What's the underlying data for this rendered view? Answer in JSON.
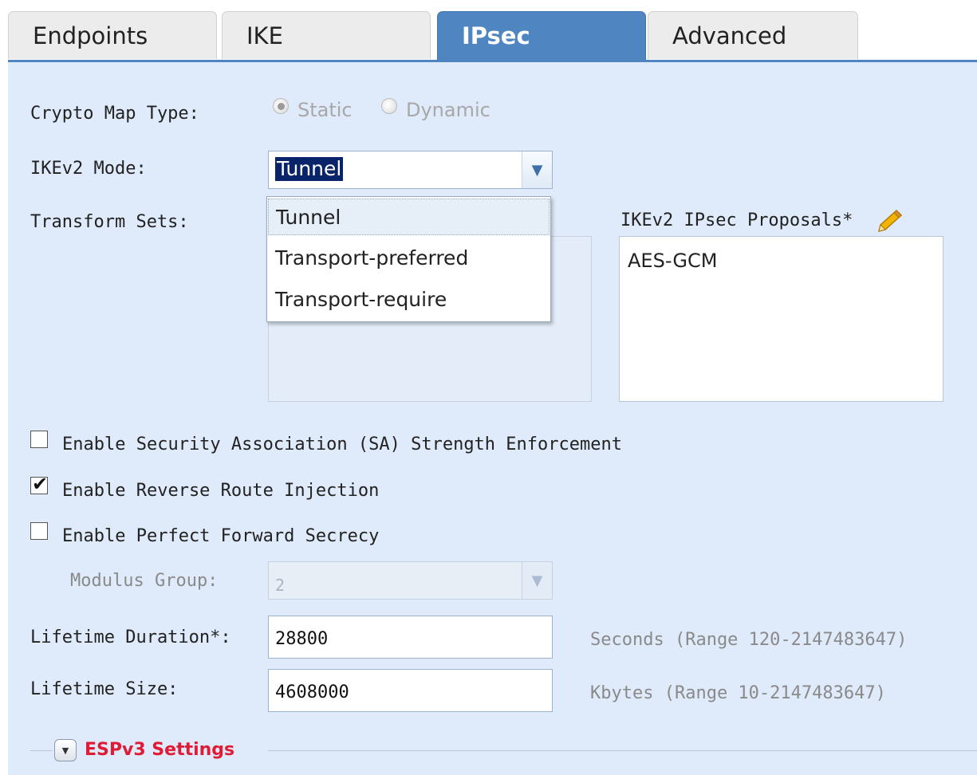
{
  "tabs": [
    {
      "label": "Endpoints"
    },
    {
      "label": "IKE"
    },
    {
      "label": "IPsec"
    },
    {
      "label": "Advanced"
    }
  ],
  "active_tab": "IPsec",
  "crypto_map": {
    "label": "Crypto Map Type:",
    "options": [
      {
        "label": "Static"
      },
      {
        "label": "Dynamic"
      }
    ],
    "selected": "Static"
  },
  "ikev2_mode": {
    "label": "IKEv2 Mode:",
    "value": "Tunnel",
    "options": [
      "Tunnel",
      "Transport-preferred",
      "Transport-require"
    ]
  },
  "transform_sets": {
    "label": "Transform Sets:"
  },
  "proposals": {
    "label": "IKEv2 IPsec Proposals*",
    "items": [
      "AES-GCM"
    ]
  },
  "checkboxes": [
    {
      "label": "Enable Security Association (SA) Strength Enforcement",
      "checked": false
    },
    {
      "label": "Enable Reverse Route Injection",
      "checked": true
    },
    {
      "label": "Enable Perfect Forward Secrecy",
      "checked": false
    }
  ],
  "modulus_group": {
    "label": "Modulus Group:",
    "value": "2"
  },
  "lifetime_duration": {
    "label": "Lifetime Duration*:",
    "value": "28800",
    "hint": "Seconds (Range 120-2147483647)"
  },
  "lifetime_size": {
    "label": "Lifetime Size:",
    "value": "4608000",
    "hint": "Kbytes (Range 10-2147483647)"
  },
  "esp_section": {
    "title": "ESPv3 Settings"
  },
  "icons": {
    "edit": "pencil-icon",
    "collapse": "chevron-down-icon",
    "dropdown": "chevron-down-icon"
  }
}
